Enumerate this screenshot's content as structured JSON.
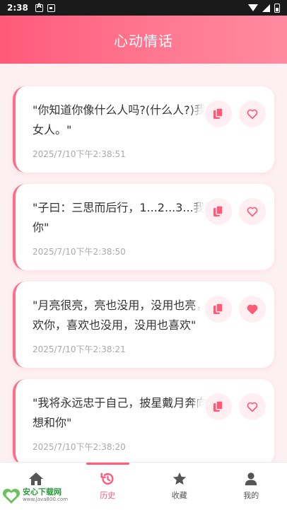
{
  "status_bar": {
    "time": "2:38"
  },
  "header": {
    "title": "心动情话"
  },
  "cards": [
    {
      "line1": "\"你知道你像什么人吗?(什么人?)我",
      "line2": "女人。\"",
      "time": "2025/7/10下午2:38:51",
      "favorited": false
    },
    {
      "line1": "\"子曰：三思而后行，1...2...3...我喜",
      "line2": "你\"",
      "time": "2025/7/10下午2:38:50",
      "favorited": false
    },
    {
      "line1": "\"月亮很亮，亮也没用，没用也亮，",
      "line2": "欢你，喜欢也没用，没用也喜欢\"",
      "time": "2025/7/10下午2:38:21",
      "favorited": true
    },
    {
      "line1": "\"我将永远忠于自己，披星戴月奔向",
      "line2": "想和你\"",
      "time": "2025/7/10下午2:38:20",
      "favorited": false
    }
  ],
  "nav": {
    "items": [
      {
        "label": "",
        "icon": "home-icon"
      },
      {
        "label": "历史",
        "icon": "history-icon"
      },
      {
        "label": "收藏",
        "icon": "star-icon"
      },
      {
        "label": "我的",
        "icon": "user-icon"
      }
    ],
    "active_index": 1
  },
  "watermark": {
    "name": "安心下载网",
    "url": "www.Java800.com"
  },
  "colors": {
    "accent": "#ff5a78",
    "card_border": "#ff6f8a",
    "background": "#fdf0f3"
  }
}
